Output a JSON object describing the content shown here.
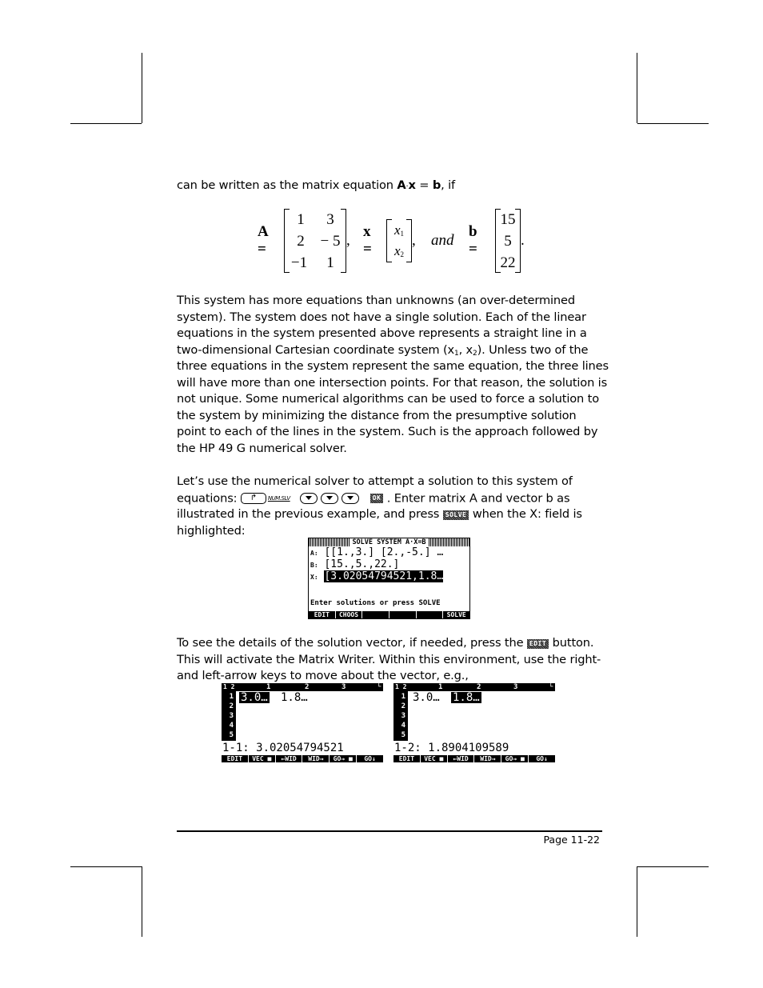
{
  "intro": {
    "pre": "can be written as the matrix equation ",
    "A": "A",
    "dot": "·",
    "x": "x",
    "eq": " = ",
    "b": "b",
    "post": ", if"
  },
  "math": {
    "A_label": "A =",
    "A": [
      [
        "1",
        "3"
      ],
      [
        "2",
        "− 5"
      ],
      [
        "−1",
        "1"
      ]
    ],
    "x_label": "x =",
    "x": [
      "x",
      "x"
    ],
    "x_subs": [
      "1",
      "2"
    ],
    "and": "and",
    "b_label": "b =",
    "b": [
      "15",
      "5",
      "22"
    ],
    "comma": ",",
    "period": "."
  },
  "para1": {
    "part1": "This system has more equations than unknowns (an over-determined system). The system does not have a single solution.     Each of the linear equations in the system presented above represents a straight line in a two-dimensional Cartesian coordinate system (x",
    "sub1": "1",
    "mid": ", x",
    "sub2": "2",
    "part2": ").  Unless two of the three equations in the system represent the same equation, the three lines will have more than one intersection points.  For that reason, the solution is not unique.  Some numerical algorithms can be used to force a solution to the system by minimizing the distance from the presumptive solution point to each of the lines in the system.   Such is the approach followed by the HP 49 G numerical solver."
  },
  "para2": {
    "line1": "Let’s use the numerical solver to attempt a solution to this system of equations:",
    "keys": {
      "shift_icon": "right-shift-key",
      "shift_glyph": "↱",
      "numslv": "NUM.SLV",
      "down_count": 3,
      "ok_softkey": "OK"
    },
    "after_keys": " .   Enter matrix A and vector b as illustrated in the previous example, and press ",
    "solve_softkey": "SOLVE",
    "end": " when the X: field is highlighted:"
  },
  "screen1": {
    "title": "SOLVE SYSTEM A·X=B",
    "rows": [
      {
        "label": "A:",
        "value": "[[1.,3.] [2.,-5.] …"
      },
      {
        "label": "B:",
        "value": "[15.,5.,22.]"
      },
      {
        "label": "X:",
        "value": "[3.02054794521,1.8…"
      }
    ],
    "prompt": "Enter solutions or press SOLVE",
    "menu": [
      "EDIT",
      "CHOOS",
      "",
      "",
      "",
      "SOLVE"
    ]
  },
  "para3": {
    "pre": "To see the details of the solution vector, if needed, press the ",
    "edit_softkey": "EDIT",
    "post": "  button. This will activate the Matrix Writer.  Within this environment, use the right- and left-arrow keys to move about the vector, e.g.,"
  },
  "screen2": {
    "corner": "1 2",
    "cols": [
      "1",
      "2",
      "3"
    ],
    "right_mark": "└",
    "rows": [
      "1",
      "2",
      "3",
      "4",
      "5"
    ],
    "cells": [
      "3.0…",
      "1.8…"
    ],
    "selected": 0,
    "status": "1-1:  3.02054794521",
    "menu": [
      "EDIT",
      "VEC ■",
      "←WID",
      "WID→",
      "GO→ ■",
      "GO↓"
    ]
  },
  "screen3": {
    "corner": "1 2",
    "cols": [
      "1",
      "2",
      "3"
    ],
    "right_mark": "└",
    "rows": [
      "1",
      "2",
      "3",
      "4",
      "5"
    ],
    "cells": [
      "3.0…",
      "1.8…"
    ],
    "selected": 1,
    "status": "1-2:  1.8904109589",
    "menu": [
      "EDIT",
      "VEC ■",
      "←WID",
      "WID→",
      "GO→ ■",
      "GO↓"
    ]
  },
  "footer": {
    "page": "Page 11-22"
  }
}
